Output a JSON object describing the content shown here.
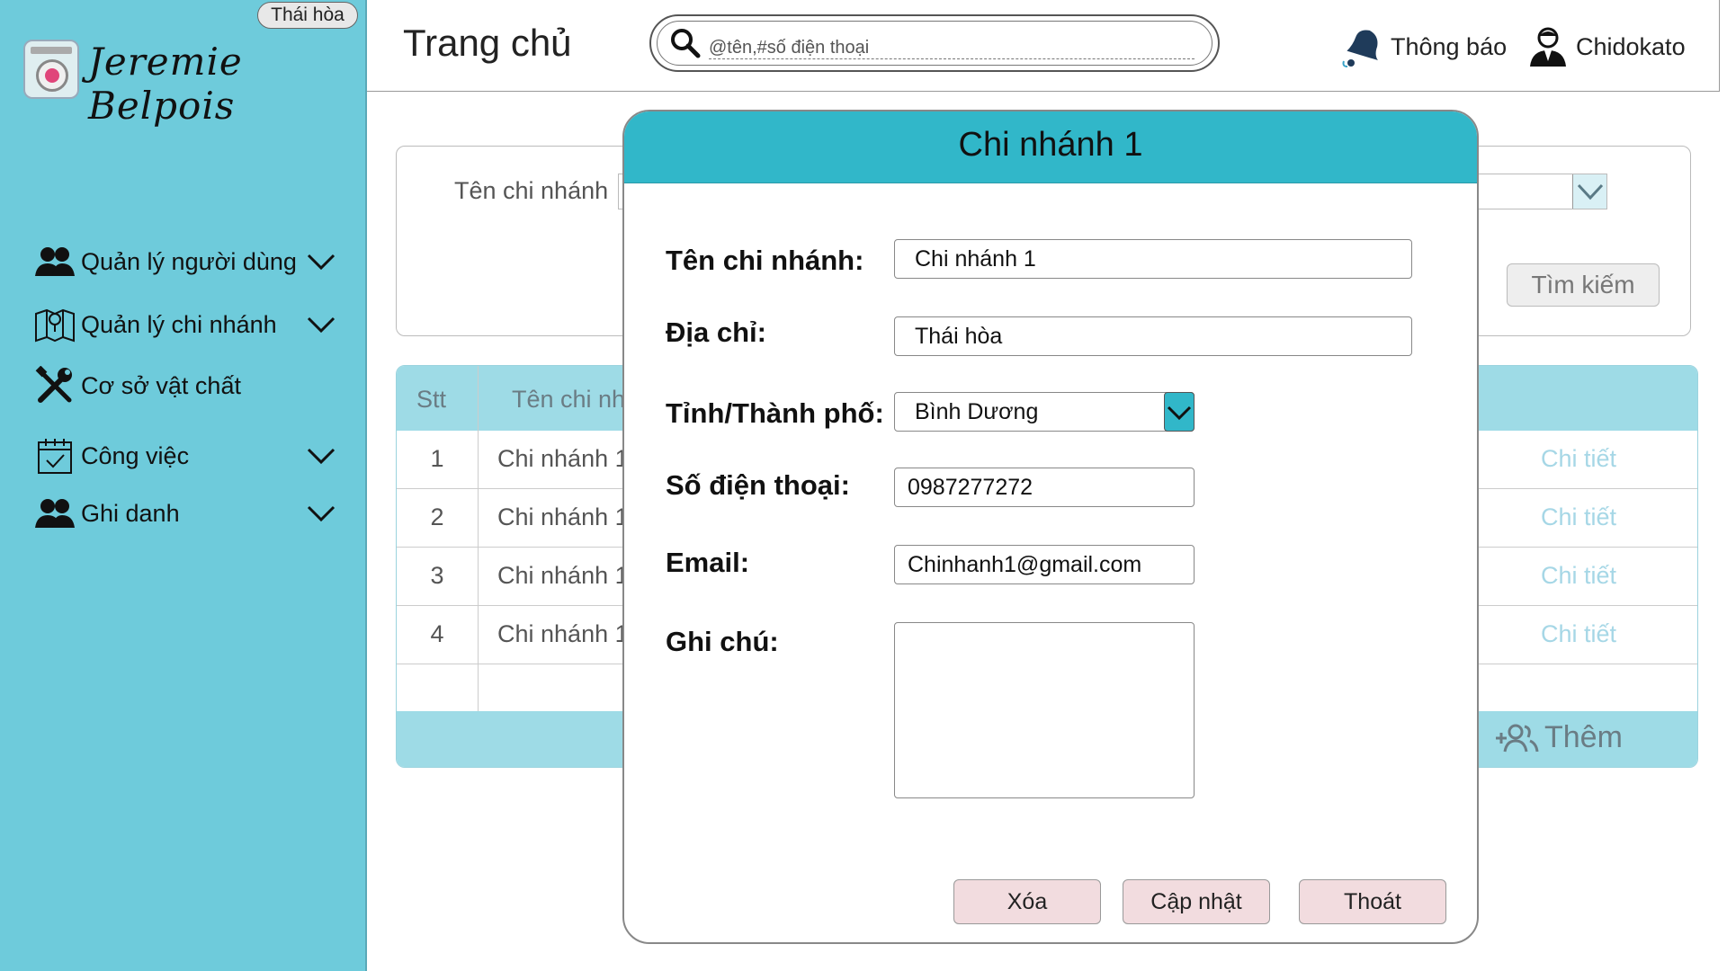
{
  "app": {
    "location_badge": "Thái hòa",
    "brand": "Jeremie Belpois"
  },
  "sidebar": {
    "items": [
      {
        "label": "Quản lý người dùng",
        "icon": "users-icon",
        "has_chevron": true
      },
      {
        "label": "Quản lý chi nhánh",
        "icon": "map-icon",
        "has_chevron": true
      },
      {
        "label": "Cơ sở vật chất",
        "icon": "tools-icon",
        "has_chevron": false
      },
      {
        "label": "Công việc",
        "icon": "calendar-check-icon",
        "has_chevron": true
      },
      {
        "label": "Ghi danh",
        "icon": "users-icon",
        "has_chevron": true
      }
    ]
  },
  "header": {
    "title": "Trang chủ",
    "search_placeholder": "@tên,#số điện thoại",
    "notifications_label": "Thông báo",
    "user_name": "Chidokato"
  },
  "filter": {
    "label": "Tên chi nhánh",
    "search_button": "Tìm kiếm"
  },
  "table": {
    "headers": [
      "Stt",
      "Tên chi nh"
    ],
    "rows": [
      {
        "stt": "1",
        "name": "Chi nhánh 1",
        "action": "Chi tiết"
      },
      {
        "stt": "2",
        "name": "Chi nhánh 1",
        "action": "Chi tiết"
      },
      {
        "stt": "3",
        "name": "Chi nhánh 1",
        "action": "Chi tiết"
      },
      {
        "stt": "4",
        "name": "Chi nhánh 1",
        "action": "Chi tiết"
      }
    ],
    "add_button": "Thêm"
  },
  "modal": {
    "title": "Chi nhánh 1",
    "fields": {
      "name_label": "Tên chi nhánh:",
      "name_value": "Chi nhánh 1",
      "address_label": "Địa chỉ:",
      "address_value": "Thái hòa",
      "province_label": "Tỉnh/Thành phố:",
      "province_value": "Bình Dương",
      "phone_label": "Số điện thoại:",
      "phone_value": "0987277272",
      "email_label": "Email:",
      "email_value": "Chinhanh1@gmail.com",
      "note_label": "Ghi chú:",
      "note_value": ""
    },
    "buttons": {
      "delete": "Xóa",
      "update": "Cập nhật",
      "exit": "Thoát"
    }
  },
  "colors": {
    "sidebar_bg": "#6ecbdb",
    "modal_header": "#31b7c9",
    "table_header": "#9edbe6",
    "button_bg": "#f2dcdf"
  }
}
